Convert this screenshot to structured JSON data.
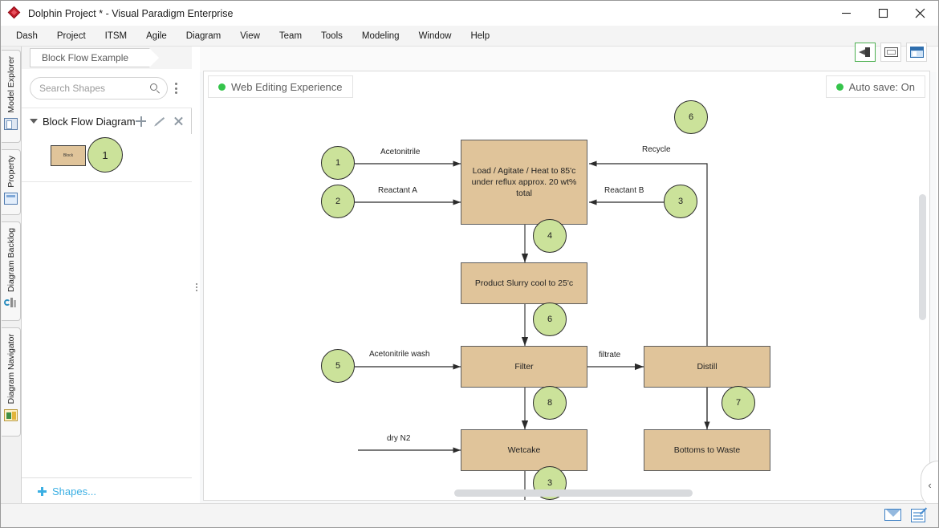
{
  "window": {
    "title": "Dolphin Project * - Visual Paradigm Enterprise",
    "logo_icon": "red-diamond-logo",
    "minimize_label": "—",
    "maximize_label": "□",
    "close_label": "✕"
  },
  "menubar": {
    "items": [
      {
        "label": "Dash"
      },
      {
        "label": "Project"
      },
      {
        "label": "ITSM"
      },
      {
        "label": "Agile"
      },
      {
        "label": "Diagram"
      },
      {
        "label": "View"
      },
      {
        "label": "Team"
      },
      {
        "label": "Tools"
      },
      {
        "label": "Modeling"
      },
      {
        "label": "Window"
      },
      {
        "label": "Help"
      }
    ]
  },
  "vertical_tabs": [
    {
      "label": "Model Explorer",
      "icon": "model-explorer-icon"
    },
    {
      "label": "Property",
      "icon": "property-icon"
    },
    {
      "label": "Diagram Backlog",
      "icon": "diagram-backlog-icon"
    },
    {
      "label": "Diagram Navigator",
      "icon": "diagram-navigator-icon"
    }
  ],
  "sidebar": {
    "document_tab": "Block Flow Example",
    "search": {
      "placeholder": "Search Shapes",
      "value": "",
      "icon": "search-icon",
      "more_icon": "kebab-menu-icon"
    },
    "group": {
      "title": "Block Flow Diagram",
      "caret_icon": "caret-down-icon",
      "add_icon": "plus-icon",
      "edit_icon": "pencil-icon",
      "close_icon": "close-icon"
    },
    "palette": [
      {
        "type": "block",
        "label": "Block"
      },
      {
        "type": "circle",
        "label": "1"
      }
    ],
    "shapes_link": "Shapes...",
    "shapes_link_icon": "plus-icon"
  },
  "editor": {
    "toolbar_icons": [
      {
        "name": "feedback-megaphone-icon",
        "selected": true
      },
      {
        "name": "fit-to-window-icon",
        "selected": false
      },
      {
        "name": "panel-layout-icon",
        "selected": false
      }
    ],
    "badges": {
      "web_editing": "Web Editing Experience",
      "auto_save": "Auto save: On"
    },
    "collapse_handle_icon": "‹"
  },
  "diagram": {
    "type": "block-flow-diagram",
    "colors": {
      "node_fill": "#e0c49a",
      "node_border": "#5e5e5e",
      "circle_fill": "#cbe29a",
      "circle_border": "#2b2b2b"
    },
    "nodes": [
      {
        "id": "load",
        "label": "Load / Agitate / Heat to 85'c under reflux approx. 20 wt% total"
      },
      {
        "id": "slurry",
        "label": "Product Slurry cool to 25'c"
      },
      {
        "id": "filter",
        "label": "Filter"
      },
      {
        "id": "distill",
        "label": "Distill"
      },
      {
        "id": "wetcake",
        "label": "Wetcake"
      },
      {
        "id": "bottoms",
        "label": "Bottoms to Waste"
      }
    ],
    "markers": [
      {
        "id": "m1",
        "label": "1"
      },
      {
        "id": "m2",
        "label": "2"
      },
      {
        "id": "m3",
        "label": "3"
      },
      {
        "id": "m6top",
        "label": "6"
      },
      {
        "id": "m4",
        "label": "4"
      },
      {
        "id": "m6mid",
        "label": "6"
      },
      {
        "id": "m5",
        "label": "5"
      },
      {
        "id": "m7",
        "label": "7"
      },
      {
        "id": "m8",
        "label": "8"
      },
      {
        "id": "m3bottom",
        "label": "3"
      }
    ],
    "edge_labels": [
      {
        "id": "e_acetonitrile",
        "label": "Acetonitrile"
      },
      {
        "id": "e_reactant_a",
        "label": "Reactant A"
      },
      {
        "id": "e_recycle",
        "label": "Recycle"
      },
      {
        "id": "e_reactant_b",
        "label": "Reactant B"
      },
      {
        "id": "e_acetonitrile_wash",
        "label": "Acetonitrile wash"
      },
      {
        "id": "e_filtrate",
        "label": "filtrate"
      },
      {
        "id": "e_dry_n2",
        "label": "dry N2"
      }
    ]
  },
  "statusbar": {
    "icons": [
      {
        "name": "mail-icon"
      },
      {
        "name": "note-edit-icon"
      }
    ]
  }
}
